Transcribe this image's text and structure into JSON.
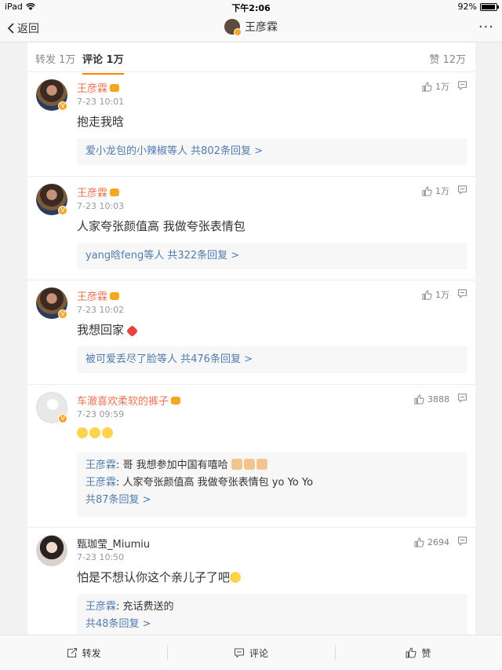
{
  "status_bar": {
    "carrier": "iPad",
    "time": "下午2:06",
    "battery": "92%",
    "battery_level": 0.92
  },
  "nav": {
    "back_label": "返回",
    "title": "王彦霖",
    "more": "···"
  },
  "tabs": {
    "repost": "转发 1万",
    "comment": "评论 1万",
    "like": "赞 12万"
  },
  "comments": [
    {
      "user": "王彦霖",
      "verified": true,
      "time": "7-23 10:01",
      "likes": "1万",
      "text": "抱走我晗",
      "reply_summary": "爱小龙包的小辣椒等人 共802条回复 >"
    },
    {
      "user": "王彦霖",
      "verified": true,
      "time": "7-23 10:03",
      "likes": "1万",
      "text": "人家夸张颜值高 我做夸张表情包",
      "reply_summary": "yang晗feng等人 共322条回复 >"
    },
    {
      "user": "王彦霖",
      "verified": true,
      "time": "7-23 10:02",
      "likes": "1万",
      "text": "我想回家",
      "reply_summary": "被可爱丢尽了脸等人 共476条回复 >"
    },
    {
      "user": "车澈喜欢柔软的裤子",
      "verified": true,
      "time": "7-23 09:59",
      "likes": "3888",
      "text": "",
      "replies": [
        {
          "name": "王彦霖",
          "text": ": 哥 我想参加中国有嘻哈"
        },
        {
          "name": "王彦霖",
          "text": ": 人家夸张颜值高 我做夸张表情包 yo Yo Yo"
        }
      ],
      "reply_summary": "共87条回复 >"
    },
    {
      "user": "甄珈莹_Miumiu",
      "verified": false,
      "time": "7-23 10:50",
      "likes": "2694",
      "text": "怕是不想认你这个亲儿子了吧",
      "replies": [
        {
          "name": "王彦霖",
          "text": ": 充话费送的"
        }
      ],
      "reply_summary": "共48条回复 >"
    }
  ],
  "toolbar": {
    "repost": "转发",
    "comment": "评论",
    "like": "赞"
  },
  "icons": [
    "wifi-icon",
    "battery-icon",
    "back-chevron-icon",
    "more-icon",
    "thumb-up-icon",
    "reply-icon",
    "repost-icon",
    "comment-icon",
    "emoji-icon",
    "broken-heart-icon",
    "crown-icon"
  ],
  "colors": {
    "accent": "#ff8200",
    "username": "#eb7350",
    "link": "#507daf"
  }
}
